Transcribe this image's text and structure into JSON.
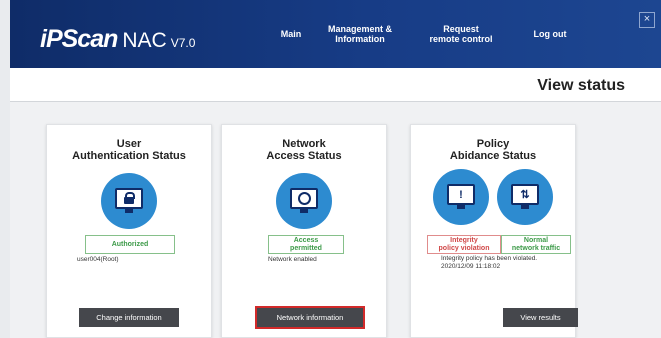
{
  "header": {
    "brand_ipscan": "iPScan",
    "brand_nac": "NAC",
    "brand_version": "V7.0",
    "nav": [
      "Main",
      "Management &\nInformation",
      "Request\nremote control",
      "Log out"
    ],
    "close": "×"
  },
  "page": {
    "title": "View status"
  },
  "cards": [
    {
      "title": "User\nAuthentication Status",
      "icon": "lock-icon",
      "badge": "Authorized",
      "detail": "user004(Root)",
      "button": "Change information"
    },
    {
      "title": "Network\nAccess Status",
      "icon": "network-monitor-icon",
      "badge": "Access\npermitted",
      "detail": "Network enabled",
      "button": "Network information"
    },
    {
      "title": "Policy\nAbidance Status",
      "icons": [
        "warning-icon",
        "traffic-icon"
      ],
      "glyphs": [
        "!",
        "⇅"
      ],
      "badges": [
        "Integrity\npolicy violation",
        "Normal\nnetwork traffic"
      ],
      "detail_lines": [
        "Integrity policy has been violated.",
        "2020/12/09 11:18:02"
      ],
      "button": "View results"
    }
  ],
  "colors": {
    "header_bg": "#173c86",
    "icon_circle": "#2d8bd0",
    "ok_green": "#3c9a48",
    "alert_red": "#d04848",
    "button_bg": "#45474c",
    "selected_outline": "#d22a2a"
  }
}
